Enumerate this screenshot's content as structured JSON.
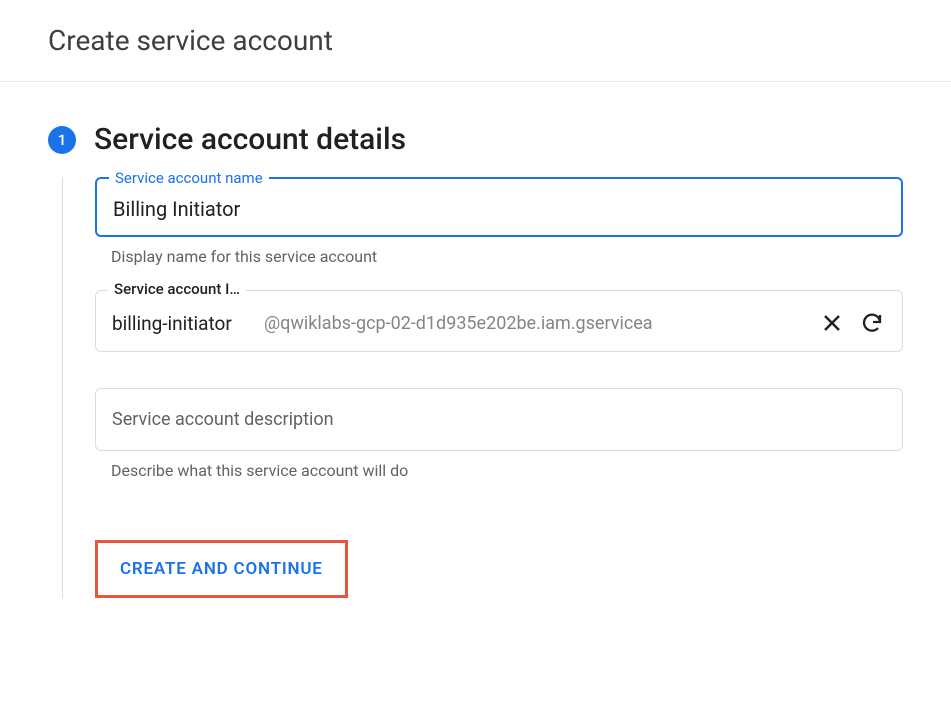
{
  "header": {
    "title": "Create service account"
  },
  "step": {
    "number": "1",
    "title": "Service account details"
  },
  "fields": {
    "name": {
      "label": "Service account name",
      "value": "Billing Initiator",
      "hint": "Display name for this service account"
    },
    "id": {
      "label": "Service account I…",
      "value": "billing-initiator",
      "suffix": "@qwiklabs-gcp-02-d1d935e202be.iam.gservicea"
    },
    "description": {
      "placeholder": "Service account description",
      "hint": "Describe what this service account will do"
    }
  },
  "buttons": {
    "create_continue": "CREATE AND CONTINUE"
  }
}
